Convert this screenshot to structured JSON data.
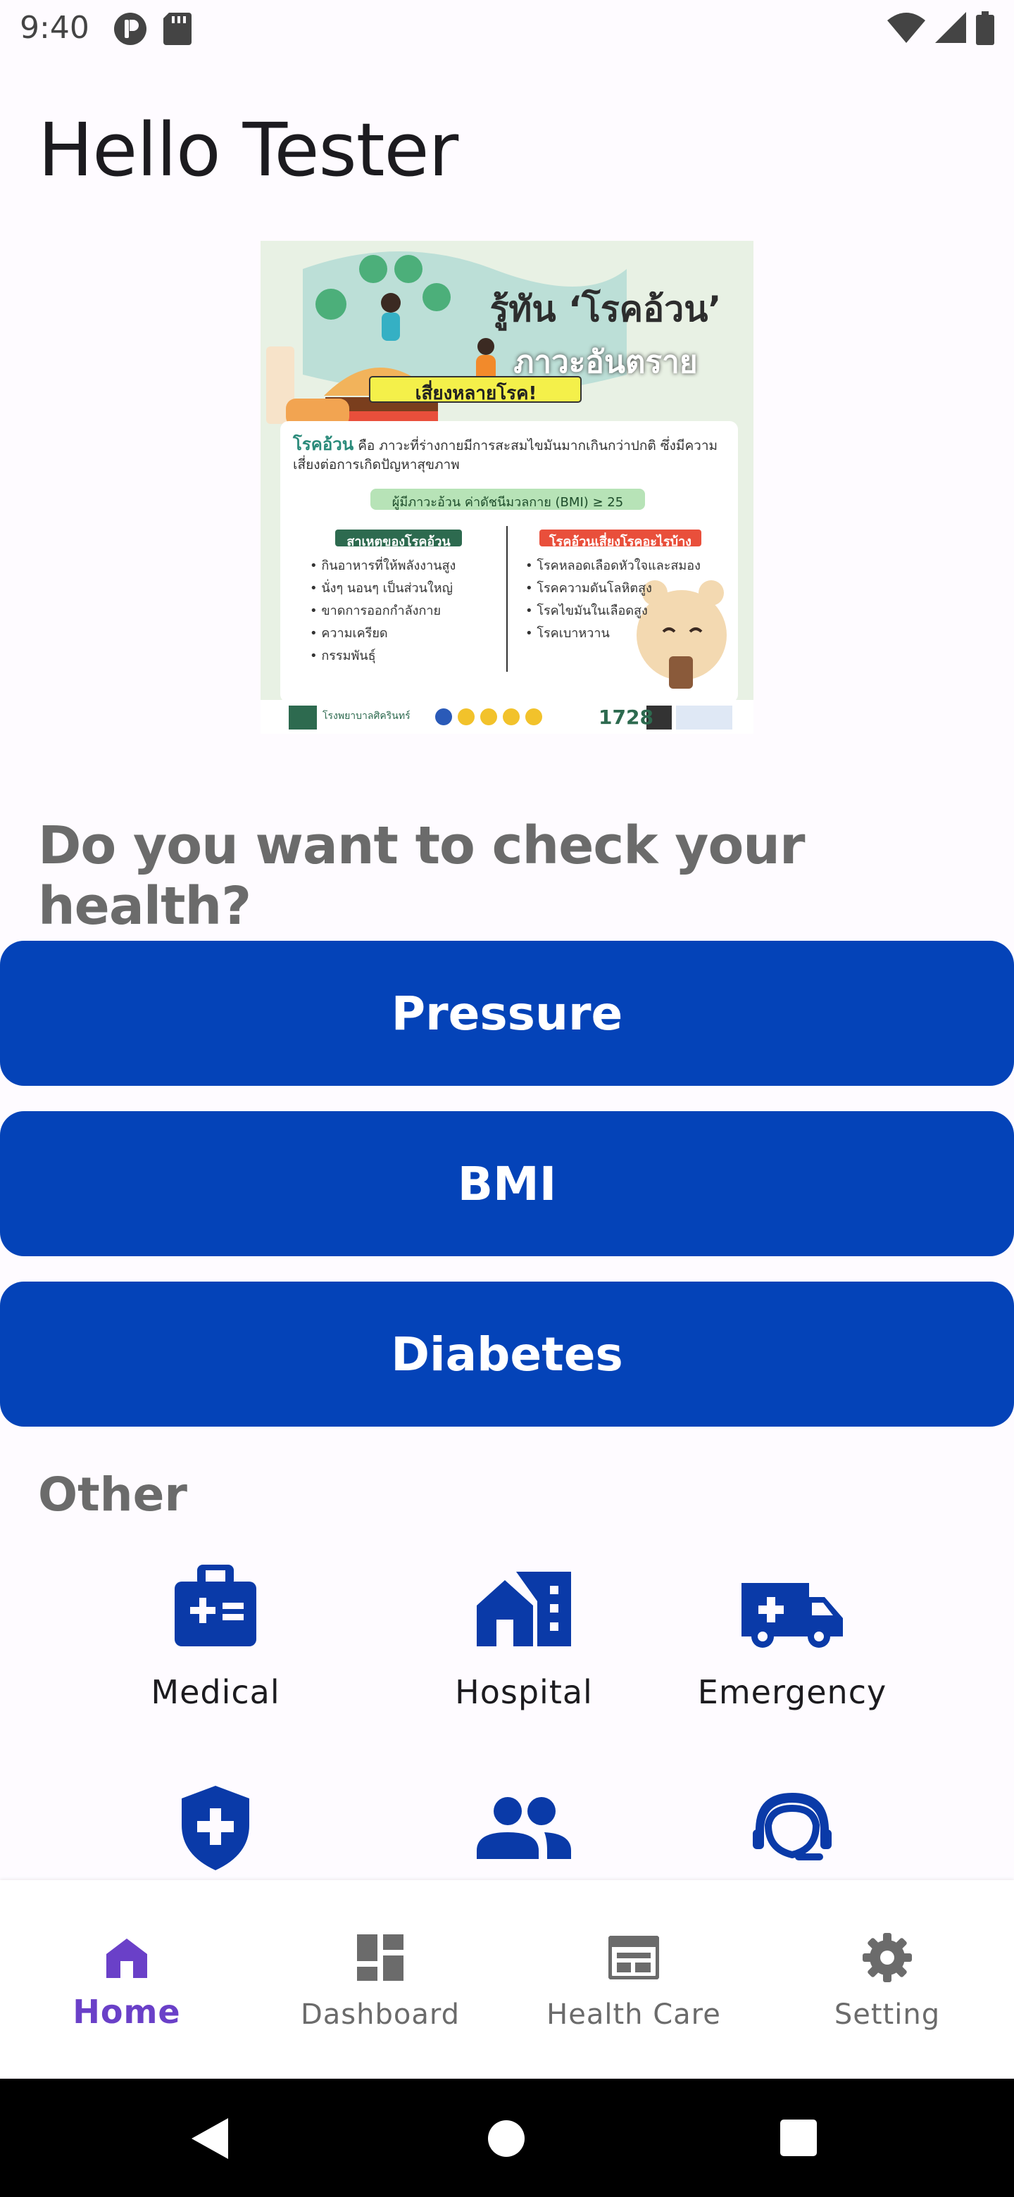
{
  "status_bar": {
    "time": "9:40",
    "icons": [
      "p-icon",
      "sd-card-icon",
      "wifi-icon",
      "signal-icon",
      "battery-icon"
    ]
  },
  "greeting": "Hello Tester",
  "banner": {
    "title_line1": "รู้ทัน ‘โรคอ้วน’",
    "title_line2": "ภาวะอันตราย",
    "title_line3": "เสี่ยงหลายโรค!",
    "definition_term": "โรคอ้วน",
    "definition": "คือ ภาวะที่ร่างกายมีการสะสมไขมันมากเกินกว่าปกติ ซึ่งมีความเสี่ยงต่อการเกิดปัญหาสุขภาพ",
    "bmi_note": "ผู้มีภาวะอ้วน ค่าดัชนีมวลกาย (BMI) ≥ 25",
    "causes_title": "สาเหตุของโรคอ้วน",
    "causes": [
      "กินอาหารที่ให้พลังงานสูง",
      "นั่งๆ นอนๆ เป็นส่วนใหญ่",
      "ขาดการออกกำลังกาย",
      "ความเครียด",
      "กรรมพันธุ์"
    ],
    "risks_title": "โรคอ้วนเสี่ยงโรคอะไรบ้าง",
    "risks": [
      "โรคหลอดเลือดหัวใจและสมอง",
      "โรคความดันโลหิตสูง",
      "โรคไขมันในเลือดสูง",
      "โรคเบาหวาน"
    ],
    "footer_hospital": "โรงพยาบาลศิครินทร์",
    "footer_phone": "1728"
  },
  "question": "Do you want to check your health?",
  "buttons": {
    "pressure": "Pressure",
    "bmi": "BMI",
    "diabetes": "Diabetes"
  },
  "other": {
    "title": "Other",
    "items": [
      {
        "label": "Medical",
        "icon": "medical-kit-icon"
      },
      {
        "label": "Hospital",
        "icon": "hospital-icon"
      },
      {
        "label": "Emergency",
        "icon": "ambulance-icon"
      },
      {
        "label": "",
        "icon": "shield-plus-icon"
      },
      {
        "label": "",
        "icon": "people-icon"
      },
      {
        "label": "",
        "icon": "support-agent-icon"
      }
    ]
  },
  "bottom_nav": {
    "home": "Home",
    "dashboard": "Dashboard",
    "health_care": "Health Care",
    "setting": "Setting"
  },
  "colors": {
    "primary_button": "#0443b8",
    "icon_blue": "#0a3aa8",
    "nav_active": "#6a40c8",
    "background": "#fefbff"
  }
}
